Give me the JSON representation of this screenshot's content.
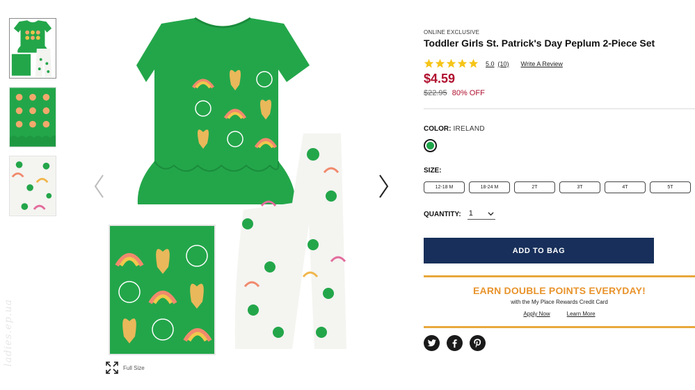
{
  "product": {
    "eyebrow": "ONLINE EXCLUSIVE",
    "title": "Toddler Girls St. Patrick's Day Peplum 2-Piece Set",
    "rating": {
      "stars": 5,
      "score": "5.0",
      "count": "(10)",
      "write_review": "Write A Review"
    },
    "price": "$4.59",
    "old_price": "$22.95",
    "discount": "80% OFF"
  },
  "color": {
    "label": "COLOR:",
    "value": "IRELAND",
    "swatch": "#1fa64a"
  },
  "size": {
    "label": "SIZE:",
    "options": [
      "12-18 M",
      "18-24 M",
      "2T",
      "3T",
      "4T",
      "5T"
    ]
  },
  "quantity": {
    "label": "QUANTITY:",
    "value": "1"
  },
  "add_to_bag": "ADD TO BAG",
  "promo": {
    "headline": "EARN DOUBLE POINTS EVERYDAY!",
    "subtext": "with the My Place Rewards Credit Card",
    "apply": "Apply Now",
    "learn": "Learn More"
  },
  "gallery": {
    "full_size": "Full Size"
  },
  "social": [
    "twitter-icon",
    "facebook-icon",
    "pinterest-icon"
  ],
  "watermark": "ladies.ep.ua",
  "colors": {
    "shirt_green": "#23a64a",
    "price_red": "#b0102e",
    "bag_navy": "#172f5a",
    "promo_orange": "#e8932c"
  }
}
